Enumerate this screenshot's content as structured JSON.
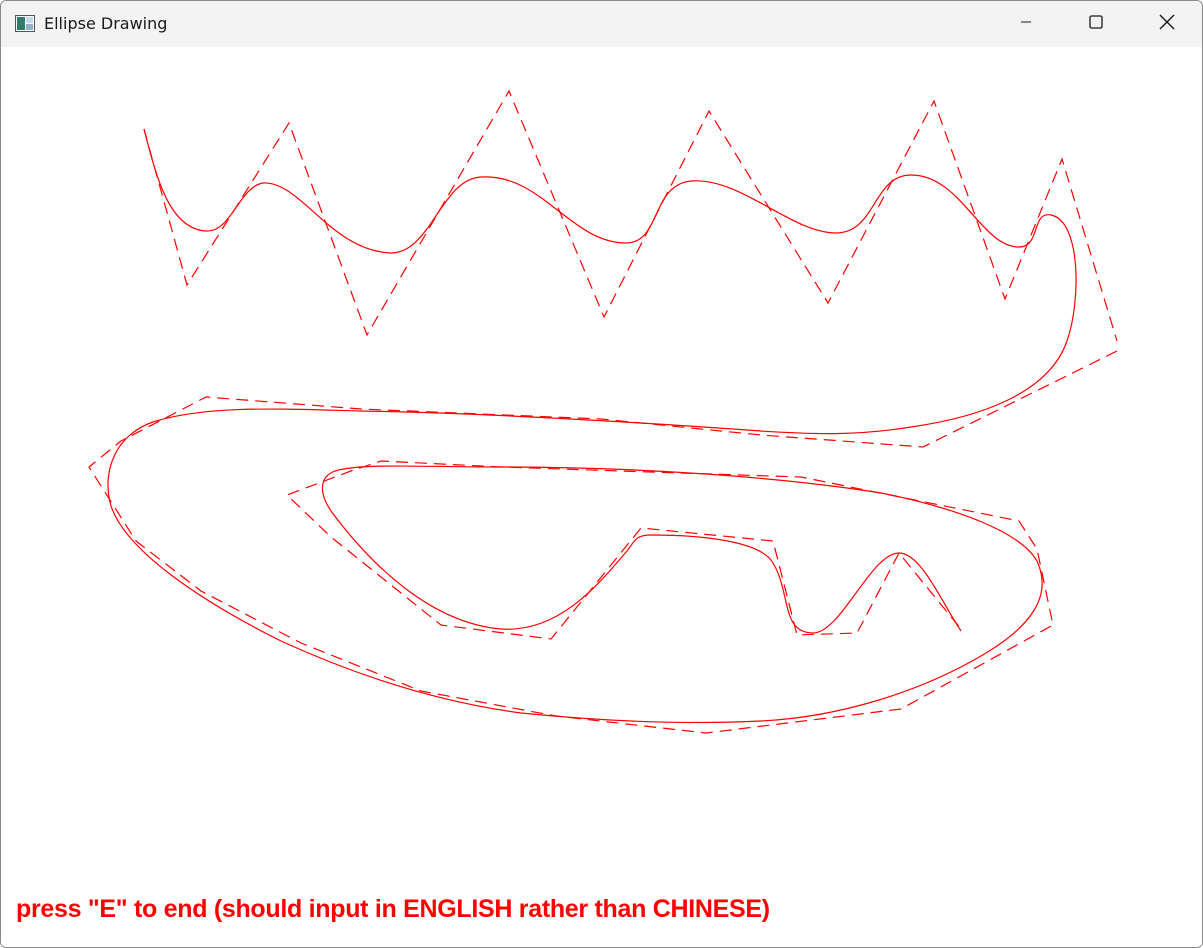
{
  "window": {
    "title": "Ellipse Drawing",
    "app_icon": "app-window-icon",
    "controls": {
      "minimize_icon": "minimize-icon",
      "maximize_icon": "maximize-icon",
      "close_icon": "close-icon"
    }
  },
  "canvas": {
    "background": "#ffffff",
    "stroke_color": "#ff0000",
    "curves": [
      {
        "name": "zigzag-control-polygon",
        "style": "dashed"
      },
      {
        "name": "zigzag-smooth-curve",
        "style": "solid"
      },
      {
        "name": "loop-control-polygon",
        "style": "dashed"
      },
      {
        "name": "loop-smooth-curve",
        "style": "solid"
      }
    ]
  },
  "status": {
    "text": "press \"E\" to end (should input in ENGLISH rather than CHINESE)",
    "color": "#ff0000"
  }
}
